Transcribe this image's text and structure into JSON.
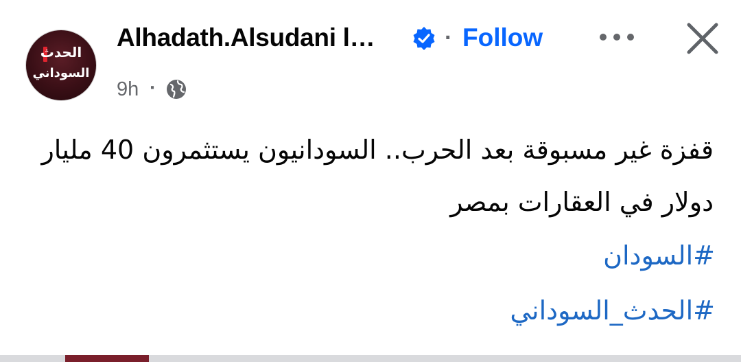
{
  "post": {
    "author": "Alhadath.Alsudani l…",
    "follow_label": "Follow",
    "separator": "·",
    "time": "9h",
    "time_separator": "·",
    "text": "قفزة غير مسبوقة بعد الحرب.. السودانيون يستثمرون 40 مليار دولار في العقارات بمصر",
    "hashtags": [
      "#السودان",
      "#الحدث_السوداني"
    ],
    "avatar": {
      "line1": "الحدث",
      "line2": "السوداني"
    }
  },
  "icons": {
    "verified": "verified-badge-icon",
    "more": "more-options-icon",
    "close": "close-icon",
    "audience": "globe-icon"
  },
  "colors": {
    "link": "#0866ff",
    "hashtag": "#1d68c4",
    "secondary_text": "#65676b",
    "avatar_accent": "#e0242f"
  }
}
